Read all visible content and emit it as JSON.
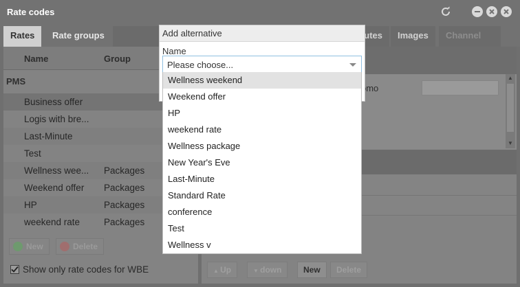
{
  "window": {
    "title": "Rate codes"
  },
  "tabs": [
    "Rates",
    "Rate groups",
    "utes",
    "Images",
    "Channel"
  ],
  "left_panel": {
    "columns": [
      "Name",
      "Group"
    ],
    "section": "PMS",
    "rows": [
      {
        "name": "Business offer",
        "group": ""
      },
      {
        "name": "Logis with bre...",
        "group": ""
      },
      {
        "name": "Last-Minute",
        "group": ""
      },
      {
        "name": "Test",
        "group": ""
      },
      {
        "name": "Wellness wee...",
        "group": "Packages"
      },
      {
        "name": "Weekend offer",
        "group": "Packages"
      },
      {
        "name": "HP",
        "group": "Packages"
      },
      {
        "name": "weekend rate",
        "group": "Packages"
      }
    ],
    "new_label": "New",
    "delete_label": "Delete",
    "checkbox_label": "Show only rate codes for WBE"
  },
  "right_panel": {
    "promo_label": "omo",
    "up_label": "Up",
    "down_label": "down",
    "new_label": "New",
    "delete_label": "Delete"
  },
  "dialog": {
    "title": "Add alternative",
    "name_label": "Name",
    "select_placeholder": "Please choose...",
    "options": [
      "Wellness weekend",
      "Weekend offer",
      "HP",
      "weekend rate",
      "Wellness package",
      "New Year's Eve",
      "Last-Minute",
      "Standard Rate",
      "conference",
      "Test",
      "Wellness v"
    ]
  }
}
